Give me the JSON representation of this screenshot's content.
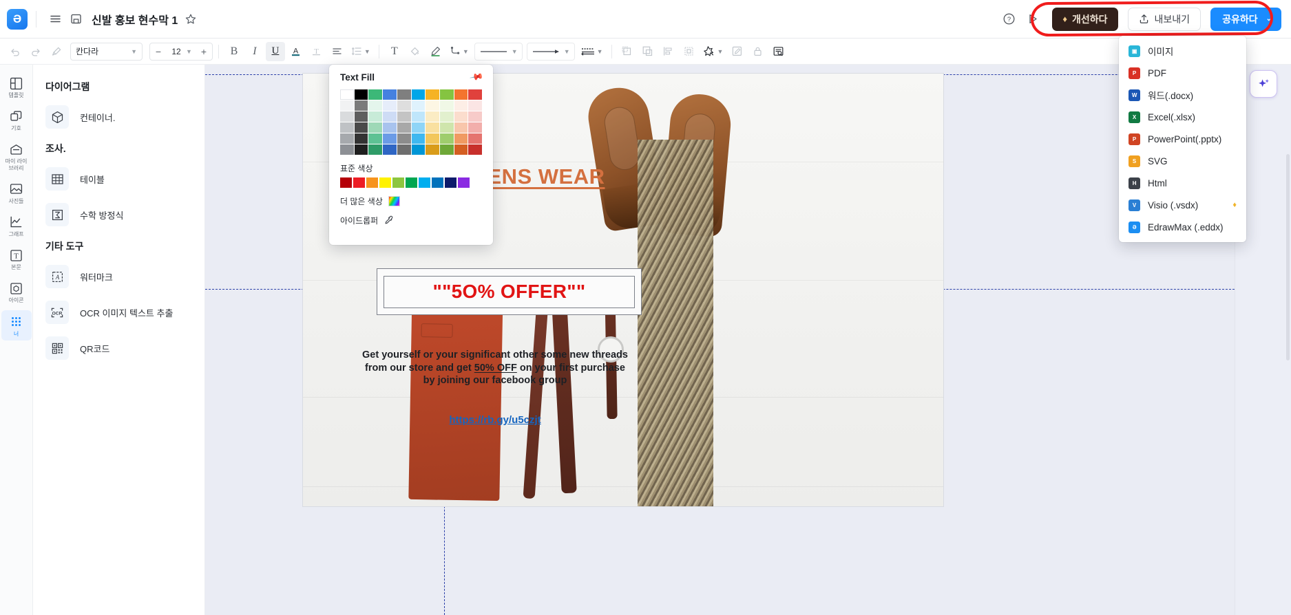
{
  "titlebar": {
    "logo": "edrawmax-logo",
    "menu_icon": "hamburger-menu-icon",
    "save_icon": "save-icon",
    "doc_title": "신발 홍보 현수막 1",
    "star_icon": "star-outline-icon",
    "help_icon": "help-circle-icon",
    "present_icon": "play-triangle-icon",
    "improve_label": "개선하다",
    "export_label": "내보내기",
    "share_label": "공유하다",
    "share_chevron": "⌄"
  },
  "toolbar": {
    "undo": "undo-icon",
    "redo": "redo-icon",
    "format_painter": "format-painter-icon",
    "font_family": "칸다라",
    "font_size": "12",
    "minus": "−",
    "plus": "+",
    "bold": "B",
    "italic": "I",
    "underline": "U",
    "text_color": "A",
    "strikethrough": "T",
    "align": "align-left-icon",
    "line_spacing": "line-spacing-icon",
    "text_box": "T",
    "shape_fill": "fill-bucket-icon",
    "line_color": "pen-icon",
    "connector": "connector-icon",
    "line_style": "line-style-icon",
    "arrow_style": "arrow-style-icon",
    "dash_style": "dash-style-icon",
    "bring_front": "bring-front-icon",
    "send_back": "send-back-icon",
    "align_objects": "align-objects-icon",
    "group": "group-icon",
    "effects": "effects-icon",
    "edit_shape": "edit-shape-icon",
    "lock": "lock-icon",
    "find": "find-replace-icon"
  },
  "rail": {
    "items": [
      {
        "icon": "template-icon",
        "label": "템플릿",
        "selected": false
      },
      {
        "icon": "symbol-icon",
        "label": "기호",
        "selected": false
      },
      {
        "icon": "my-library-icon",
        "label": "마이 라이\n브러리",
        "selected": false
      },
      {
        "icon": "photos-icon",
        "label": "사진들",
        "selected": false
      },
      {
        "icon": "graph-icon",
        "label": "그래프",
        "selected": false
      },
      {
        "icon": "text-icon",
        "label": "본문",
        "selected": false
      },
      {
        "icon": "icons-icon",
        "label": "아이콘",
        "selected": false
      },
      {
        "icon": "more-dots-icon",
        "label": "너",
        "selected": true
      }
    ]
  },
  "panel": {
    "sections": [
      {
        "heading": "다이어그램",
        "rows": [
          {
            "icon": "cube-icon",
            "label": "컨테이너."
          }
        ]
      },
      {
        "heading": "조사.",
        "rows": [
          {
            "icon": "table-icon",
            "label": "테이블"
          },
          {
            "icon": "sigma-icon",
            "label": "수학 방정식"
          }
        ]
      },
      {
        "heading": "기타 도구",
        "rows": [
          {
            "icon": "watermark-icon",
            "label": "워터마크"
          },
          {
            "icon": "ocr-icon",
            "label": "OCR 이미지 텍스트 추출"
          },
          {
            "icon": "qrcode-icon",
            "label": "QR코드"
          }
        ]
      }
    ]
  },
  "popover": {
    "title": "Text Fill",
    "pin_icon": "pin-icon",
    "theme_colors": [
      [
        "#ffffff",
        "#000000",
        "#3cb878",
        "#4581e0",
        "#7f7f7f",
        "#00a6e8",
        "#f5b324",
        "#85c441",
        "#f4742e",
        "#e0413c"
      ],
      [
        "#f1f2f3",
        "#7b7b7b",
        "#e4f5ec",
        "#e6edfa",
        "#dedede",
        "#dff2fd",
        "#fdf6e4",
        "#f0f8e6",
        "#fdeee6",
        "#fbe5e4"
      ],
      [
        "#d9dbdd",
        "#5e5e5e",
        "#c8ebd8",
        "#cedcf5",
        "#c4c4c4",
        "#bfe6fb",
        "#fbecc4",
        "#e2f0ce",
        "#fbddcd",
        "#f7cbc9"
      ],
      [
        "#bfc2c5",
        "#4a4a4a",
        "#9ed8b7",
        "#a8c3ee",
        "#a8a8a8",
        "#8fd5f7",
        "#f9e0a0",
        "#cfe5ac",
        "#f8c6ab",
        "#f2aeab"
      ],
      [
        "#a6a9ad",
        "#333333",
        "#5ec294",
        "#6b9be6",
        "#8c8c8c",
        "#3fb8f0",
        "#f2c75c",
        "#9fcd6d",
        "#f09a62",
        "#e5746f"
      ],
      [
        "#8d9095",
        "#1f1f1f",
        "#2f9c68",
        "#2f66c4",
        "#6e6e6e",
        "#0096d6",
        "#d99c1a",
        "#6fa838",
        "#d45f22",
        "#c8302c"
      ]
    ],
    "standard_label": "표준 색상",
    "standard_colors": [
      "#b50008",
      "#ed1c24",
      "#f7941e",
      "#fff200",
      "#8dc63f",
      "#00a651",
      "#00aeef",
      "#0072bc",
      "#0d1b6b",
      "#8a2be2"
    ],
    "more_colors_label": "더 많은 색상",
    "more_colors_icon": "rainbow-swatch-icon",
    "eyedropper_label": "아이드롭퍼",
    "eyedropper_icon": "eyedropper-icon"
  },
  "export_menu": {
    "items": [
      {
        "label": "이미지",
        "icon": "image-icon",
        "color": "#29b6d8",
        "glyph": "▣",
        "badge": ""
      },
      {
        "label": "PDF",
        "icon": "pdf-icon",
        "color": "#d93025",
        "glyph": "P",
        "badge": ""
      },
      {
        "label": "워드(.docx)",
        "icon": "word-icon",
        "color": "#1b57b5",
        "glyph": "W",
        "badge": ""
      },
      {
        "label": "Excel(.xlsx)",
        "icon": "excel-icon",
        "color": "#117a42",
        "glyph": "X",
        "badge": ""
      },
      {
        "label": "PowerPoint(.pptx)",
        "icon": "powerpoint-icon",
        "color": "#d04423",
        "glyph": "P",
        "badge": ""
      },
      {
        "label": "SVG",
        "icon": "svg-icon",
        "color": "#f0a020",
        "glyph": "S",
        "badge": ""
      },
      {
        "label": "Html",
        "icon": "html-icon",
        "color": "#3c4149",
        "glyph": "H",
        "badge": ""
      },
      {
        "label": "Visio (.vsdx)",
        "icon": "visio-icon",
        "color": "#2a7fd4",
        "glyph": "V",
        "badge": "♦"
      },
      {
        "label": "EdrawMax (.eddx)",
        "icon": "edrawmax-icon",
        "color": "#1b8ef2",
        "glyph": "Ə",
        "badge": ""
      }
    ]
  },
  "canvas": {
    "ai_button_icon": "ai-sparkle-icon",
    "banner": {
      "title": "AKURU MENS WEAR",
      "offer": "\"\"5O% OFFER\"\"",
      "body_line1": "Get yourself or your significant other some new threads",
      "body_line2_pre": "from our store and get ",
      "body_line2_em": "50% OFF",
      "body_line2_post": " on your first purchase",
      "body_line3": "by joining our facebook group",
      "link": "https://rb.gy/u5czjt"
    }
  },
  "colors": {
    "accent_blue": "#1a8cff",
    "improve_brown": "#32201a",
    "annotation_red": "#f01c1c",
    "title_orange": "#d4703f",
    "offer_red": "#e11414",
    "link_blue": "#1565c0"
  }
}
